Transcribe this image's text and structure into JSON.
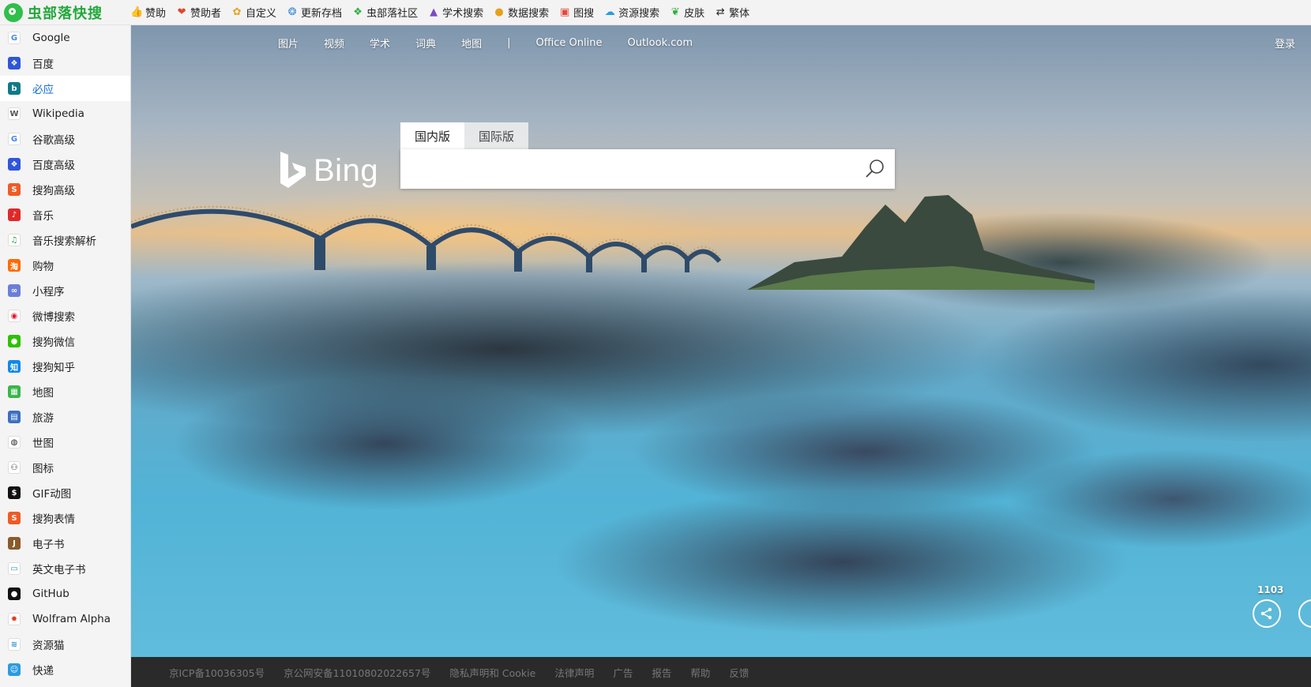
{
  "brand": {
    "name": "虫部落快搜",
    "color": "#23a83c"
  },
  "toolbar": [
    {
      "icon": "thumbs-up-icon",
      "glyph": "👍",
      "label": "赞助",
      "color": "#3a6fd8"
    },
    {
      "icon": "heart-icon",
      "glyph": "❤",
      "label": "赞助者",
      "color": "#e4452d"
    },
    {
      "icon": "gear-icon",
      "glyph": "✿",
      "label": "自定义",
      "color": "#e6a11b"
    },
    {
      "icon": "refresh-icon",
      "glyph": "❂",
      "label": "更新存档",
      "color": "#3a8ad8"
    },
    {
      "icon": "community-icon",
      "glyph": "❖",
      "label": "虫部落社区",
      "color": "#2fae3f"
    },
    {
      "icon": "graduation-cap-icon",
      "glyph": "▲",
      "label": "学术搜索",
      "color": "#7b4ac4"
    },
    {
      "icon": "database-icon",
      "glyph": "●",
      "label": "数据搜索",
      "color": "#e5a11a"
    },
    {
      "icon": "image-icon",
      "glyph": "▣",
      "label": "图搜",
      "color": "#e14b3a"
    },
    {
      "icon": "cloud-icon",
      "glyph": "☁",
      "label": "资源搜索",
      "color": "#2b9be0"
    },
    {
      "icon": "leaf-icon",
      "glyph": "❦",
      "label": "皮肤",
      "color": "#2fae3f"
    },
    {
      "icon": "swap-icon",
      "glyph": "⇄",
      "label": "繁体",
      "color": "#222222"
    }
  ],
  "sidebar": {
    "items": [
      {
        "label": "Google",
        "icon": "google-icon",
        "glyph": "G",
        "bg": "#ffffff",
        "fg": "#4285f4"
      },
      {
        "label": "百度",
        "icon": "baidu-icon",
        "glyph": "❖",
        "bg": "#2f56d9",
        "fg": "#ffffff"
      },
      {
        "label": "必应",
        "icon": "bing-icon",
        "glyph": "b",
        "bg": "#0f7a86",
        "fg": "#ffffff",
        "active": true
      },
      {
        "label": "Wikipedia",
        "icon": "wikipedia-icon",
        "glyph": "W",
        "bg": "#ffffff",
        "fg": "#555555"
      },
      {
        "label": "谷歌高级",
        "icon": "google-advanced-icon",
        "glyph": "G",
        "bg": "#ffffff",
        "fg": "#4285f4"
      },
      {
        "label": "百度高级",
        "icon": "baidu-advanced-icon",
        "glyph": "❖",
        "bg": "#2f56d9",
        "fg": "#ffffff"
      },
      {
        "label": "搜狗高级",
        "icon": "sogou-icon",
        "glyph": "S",
        "bg": "#f15a24",
        "fg": "#ffffff"
      },
      {
        "label": "音乐",
        "icon": "netease-music-icon",
        "glyph": "♪",
        "bg": "#e02828",
        "fg": "#ffffff"
      },
      {
        "label": "音乐搜索解析",
        "icon": "music-note-icon",
        "glyph": "♫",
        "bg": "#ffffff",
        "fg": "#1d9c3a"
      },
      {
        "label": "购物",
        "icon": "taobao-icon",
        "glyph": "淘",
        "bg": "#ff6a00",
        "fg": "#ffffff"
      },
      {
        "label": "小程序",
        "icon": "mini-program-icon",
        "glyph": "∞",
        "bg": "#6b7fd7",
        "fg": "#ffffff"
      },
      {
        "label": "微博搜索",
        "icon": "weibo-icon",
        "glyph": "◉",
        "bg": "#ffffff",
        "fg": "#e6162d"
      },
      {
        "label": "搜狗微信",
        "icon": "wechat-icon",
        "glyph": "●",
        "bg": "#2dc100",
        "fg": "#ffffff"
      },
      {
        "label": "搜狗知乎",
        "icon": "zhihu-icon",
        "glyph": "知",
        "bg": "#0f88eb",
        "fg": "#ffffff"
      },
      {
        "label": "地图",
        "icon": "map-icon",
        "glyph": "▦",
        "bg": "#3bb54a",
        "fg": "#ffffff"
      },
      {
        "label": "旅游",
        "icon": "travel-icon",
        "glyph": "▤",
        "bg": "#3b6fc4",
        "fg": "#ffffff"
      },
      {
        "label": "世图",
        "icon": "globe-icon",
        "glyph": "◍",
        "bg": "#ffffff",
        "fg": "#222222"
      },
      {
        "label": "图标",
        "icon": "icon-font-icon",
        "glyph": "⚇",
        "bg": "#ffffff",
        "fg": "#222222"
      },
      {
        "label": "GIF动图",
        "icon": "gif-icon",
        "glyph": "$",
        "bg": "#111111",
        "fg": "#ffffff"
      },
      {
        "label": "搜狗表情",
        "icon": "sogou-emoji-icon",
        "glyph": "S",
        "bg": "#f15a24",
        "fg": "#ffffff"
      },
      {
        "label": "电子书",
        "icon": "ebook-icon",
        "glyph": "J",
        "bg": "#8b5a2b",
        "fg": "#ffffff"
      },
      {
        "label": "英文电子书",
        "icon": "book-icon",
        "glyph": "▭",
        "bg": "#ffffff",
        "fg": "#2a8fb0"
      },
      {
        "label": "GitHub",
        "icon": "github-icon",
        "glyph": "●",
        "bg": "#111111",
        "fg": "#ffffff"
      },
      {
        "label": "Wolfram Alpha",
        "icon": "wolfram-icon",
        "glyph": "✸",
        "bg": "#ffffff",
        "fg": "#e23a1c"
      },
      {
        "label": "资源猫",
        "icon": "resource-cat-icon",
        "glyph": "≋",
        "bg": "#ffffff",
        "fg": "#2a8fd8"
      },
      {
        "label": "快递",
        "icon": "express-icon",
        "glyph": "☺",
        "bg": "#2b9be0",
        "fg": "#ffffff"
      }
    ]
  },
  "main": {
    "nav": [
      "图片",
      "视频",
      "学术",
      "词典",
      "地图",
      "|",
      "Office Online",
      "Outlook.com"
    ],
    "login": "登录",
    "logo_text": "Bing",
    "tabs": [
      {
        "label": "国内版",
        "active": true
      },
      {
        "label": "国际版",
        "active": false
      }
    ],
    "search": {
      "value": "",
      "placeholder": ""
    },
    "count": "1103"
  },
  "footer": [
    "京ICP备10036305号",
    "京公网安备11010802022657号",
    "隐私声明和 Cookie",
    "法律声明",
    "广告",
    "报告",
    "帮助",
    "反馈"
  ]
}
